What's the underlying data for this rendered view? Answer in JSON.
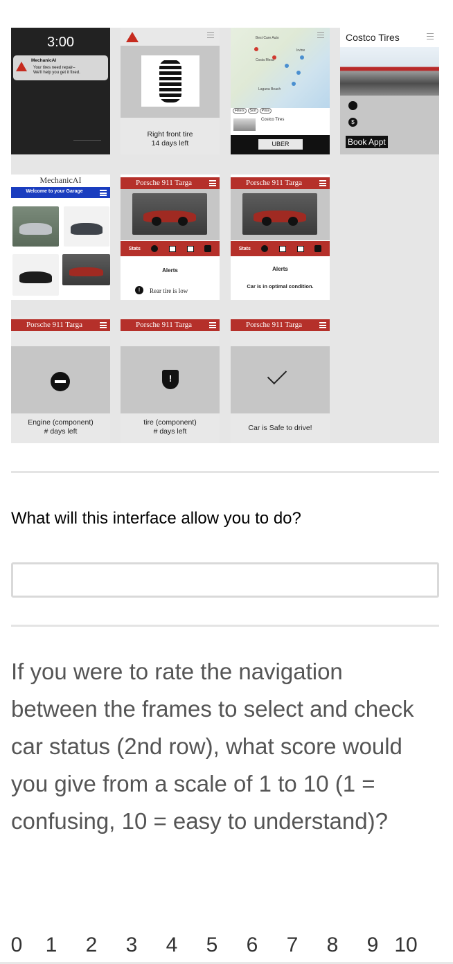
{
  "frame1": {
    "time": "3:00",
    "notif_app": "MechanicAI",
    "notif_line1": "Your tires need repair–",
    "notif_line2": "We'll help you get it fixed."
  },
  "frame2": {
    "caption1": "Right front tire",
    "caption2": "14 days left"
  },
  "frame3": {
    "map_labels": [
      "Best Care Auto",
      "Costa Mesa",
      "Irvine",
      "Laguna Beach"
    ],
    "chips": [
      "Filters",
      "Sort",
      "Price"
    ],
    "listing": "Costco Tires",
    "uber": "UBER"
  },
  "frame4": {
    "title": "Costco Tires",
    "book": "Book Appt"
  },
  "frame5": {
    "title": "MechanicAI",
    "welcome": "Welcome to your Garage"
  },
  "porsche_title": "Porsche 911 Targa",
  "frame6": {
    "stats": "Stats",
    "alerts": "Alerts",
    "alert_text": "Rear tire is low"
  },
  "frame7": {
    "stats": "Stats",
    "alerts": "Alerts",
    "alert_text": "Car is in optimal condition."
  },
  "frame8": {
    "caption1": "Engine (component)",
    "caption2": "# days left"
  },
  "frame9": {
    "caption1": "tire (component)",
    "caption2": "# days left"
  },
  "frame10": {
    "caption1": "Car is Safe to drive!"
  },
  "question1": "What will this interface allow you to do?",
  "answer_value": "",
  "question2": "If you were to rate the navigation between the frames to select and check car status (2nd row), what score would you give from a scale of 1 to 10 (1 = confusing, 10 = easy to understand)?",
  "scale": [
    "0",
    "1",
    "2",
    "3",
    "4",
    "5",
    "6",
    "7",
    "8",
    "9",
    "10"
  ],
  "colors": {
    "brand_red": "#b5302a",
    "header_blue": "#1a3dbf",
    "dark": "#222222"
  }
}
